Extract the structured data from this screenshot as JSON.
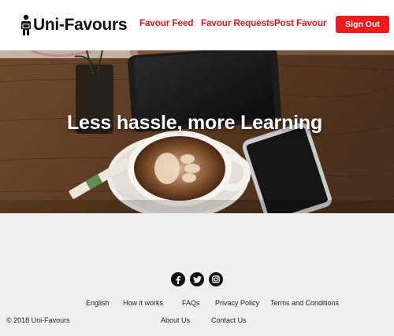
{
  "header": {
    "brand": "Uni-Favours",
    "logo_icon": "person-icon",
    "nav": {
      "feed": "Favour Feed",
      "requests": "Favour Requests",
      "post": "Post Favour"
    },
    "signout_label": "Sign Out",
    "accent_color": "#e3141b"
  },
  "hero": {
    "title": "Less hassle, more Learning"
  },
  "footer": {
    "socials": [
      "facebook-icon",
      "twitter-icon",
      "instagram-icon"
    ],
    "links_row1": {
      "english": "English",
      "how_it_works": "How it works",
      "faqs": "FAQs",
      "privacy": "Privacy Policy",
      "terms": "Terms and Conditions"
    },
    "links_row2": {
      "about": "About Us",
      "contact": "Contact Us"
    },
    "copyright": "© 2018 Uni-Favours",
    "background_color": "#efefef"
  }
}
